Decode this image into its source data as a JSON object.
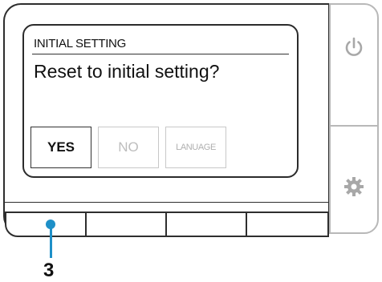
{
  "screen": {
    "title": "INITIAL SETTING",
    "message": "Reset to initial setting?",
    "softkeys": [
      {
        "label": "YES",
        "state": "enabled"
      },
      {
        "label": "NO",
        "state": "disabled"
      },
      {
        "label": "LANUAGE",
        "state": "disabled"
      }
    ]
  },
  "side_buttons": [
    {
      "icon": "power-icon"
    },
    {
      "icon": "gear-icon"
    }
  ],
  "hardware_keys": 4,
  "callout": {
    "label": "3",
    "color": "#1e90c8"
  },
  "colors": {
    "disabled": "#bdbdbd",
    "panel_outline": "#b8b8b8"
  }
}
